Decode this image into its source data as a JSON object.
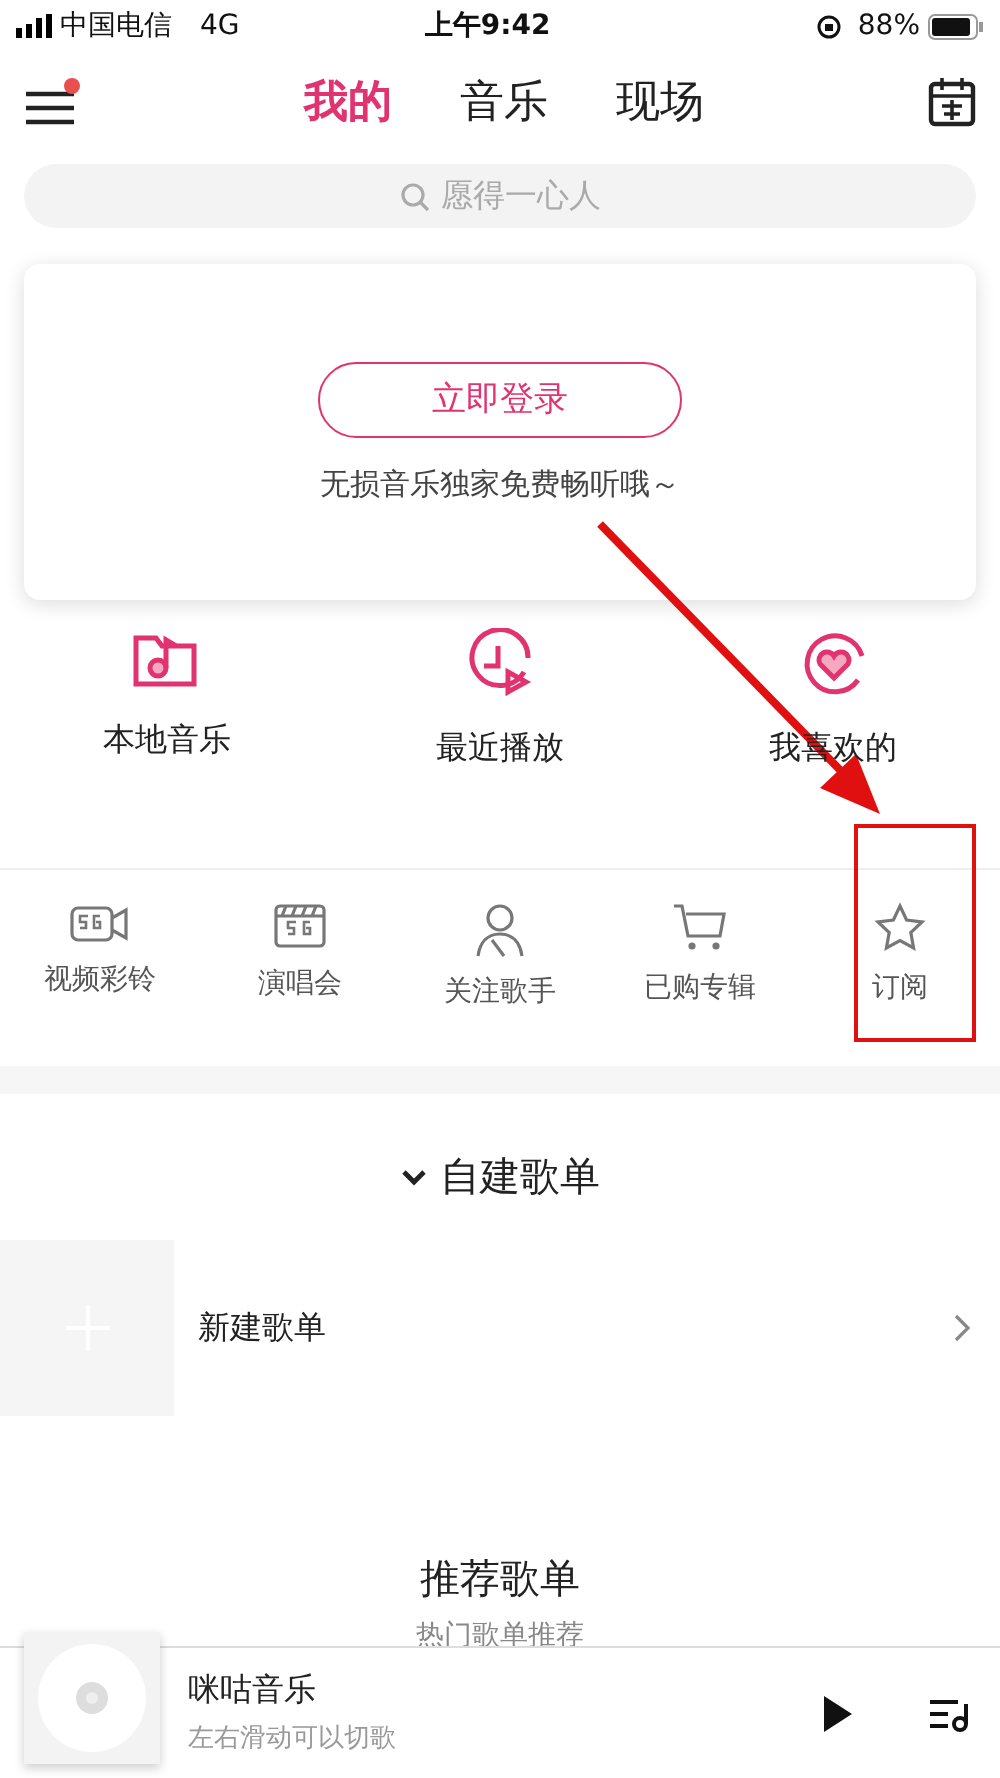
{
  "status_bar": {
    "carrier": "中国电信",
    "network": "4G",
    "time": "上午9:42",
    "battery": "88%"
  },
  "nav": {
    "has_notice": true,
    "tabs": [
      {
        "label": "我的",
        "selected": true
      },
      {
        "label": "音乐",
        "selected": false
      },
      {
        "label": "现场",
        "selected": false
      }
    ]
  },
  "search": {
    "placeholder": "愿得一心人"
  },
  "login_card": {
    "button": "立即登录",
    "subtitle": "无损音乐独家免费畅听哦～"
  },
  "quick_links": [
    {
      "kind": "local",
      "label": "本地音乐"
    },
    {
      "kind": "recent",
      "label": "最近播放"
    },
    {
      "kind": "favorite",
      "label": "我喜欢的"
    }
  ],
  "features": [
    {
      "kind": "video",
      "label": "视频彩铃"
    },
    {
      "kind": "concert",
      "label": "演唱会"
    },
    {
      "kind": "singer",
      "label": "关注歌手"
    },
    {
      "kind": "cart",
      "label": "已购专辑"
    },
    {
      "kind": "star",
      "label": "订阅"
    }
  ],
  "my_playlists": {
    "title": "自建歌单",
    "expanded": true,
    "new_item": "新建歌单"
  },
  "recommend": {
    "title": "推荐歌单",
    "subtitle": "热门歌单推荐"
  },
  "player": {
    "title": "咪咕音乐",
    "hint": "左右滑动可以切歌"
  }
}
